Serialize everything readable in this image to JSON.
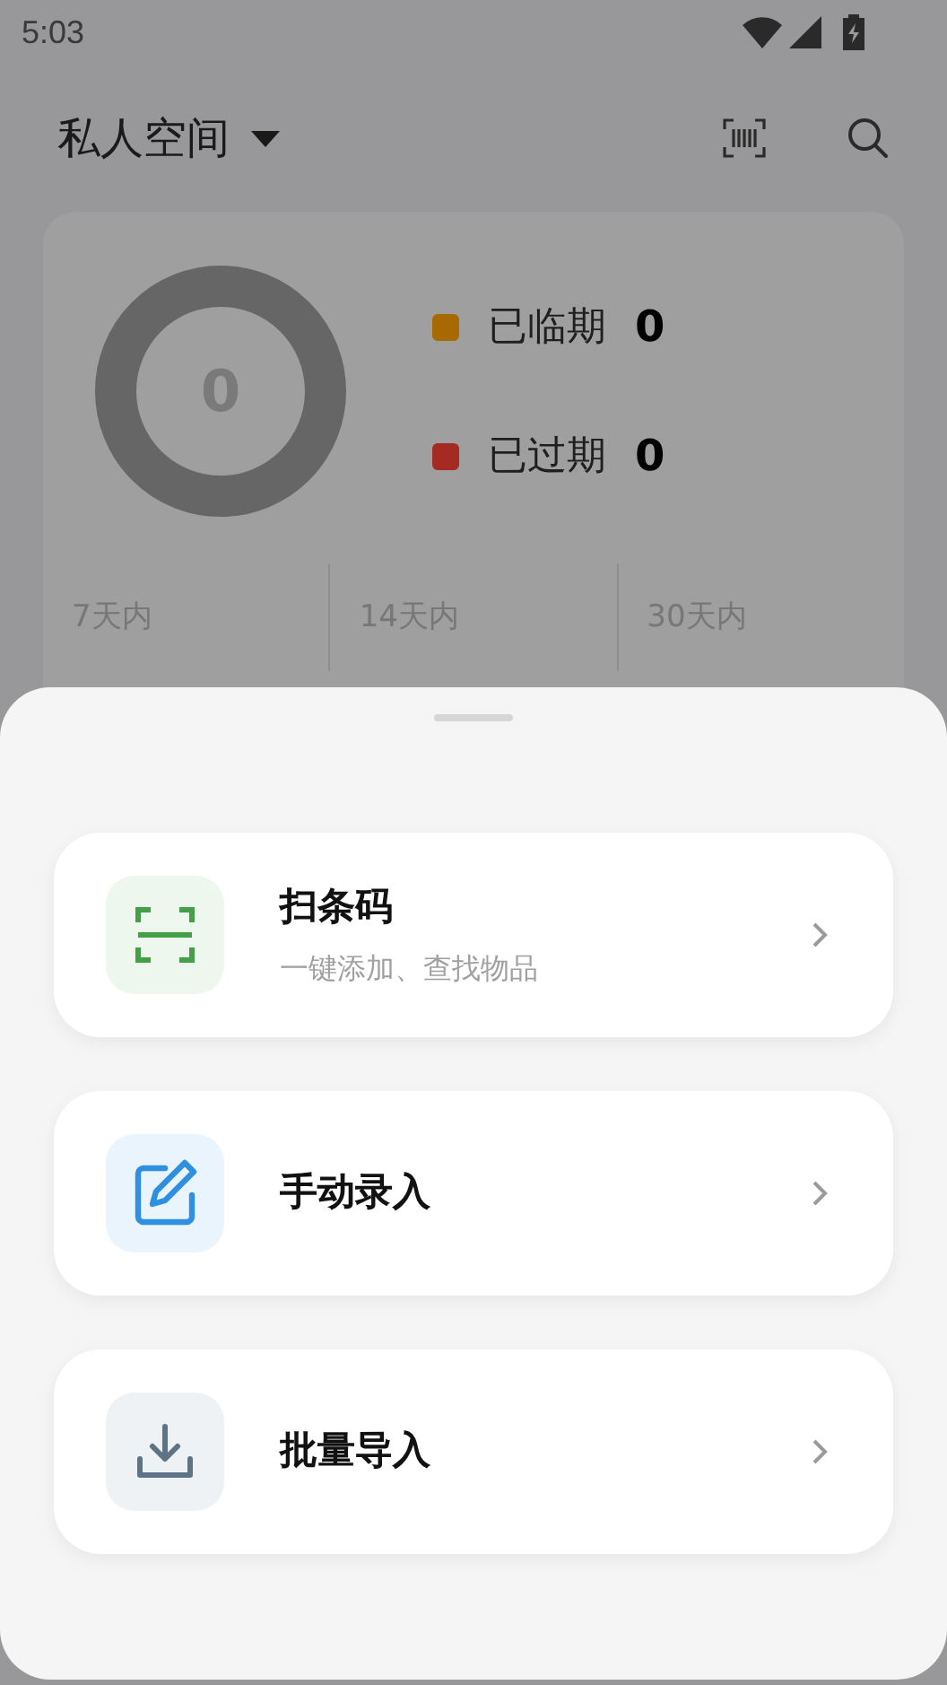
{
  "status_bar": {
    "time": "5:03"
  },
  "header": {
    "title": "私人空间"
  },
  "summary": {
    "total": "0",
    "legend": [
      {
        "label": "已临期",
        "count": "0",
        "color": "#a86a00"
      },
      {
        "label": "已过期",
        "count": "0",
        "color": "#a52a22"
      }
    ],
    "periods": [
      "7天内",
      "14天内",
      "30天内"
    ]
  },
  "sheet": {
    "options": [
      {
        "kind": "scan",
        "title": "扫条码",
        "subtitle": "一键添加、查找物品"
      },
      {
        "kind": "edit",
        "title": "手动录入"
      },
      {
        "kind": "import",
        "title": "批量导入"
      }
    ]
  }
}
